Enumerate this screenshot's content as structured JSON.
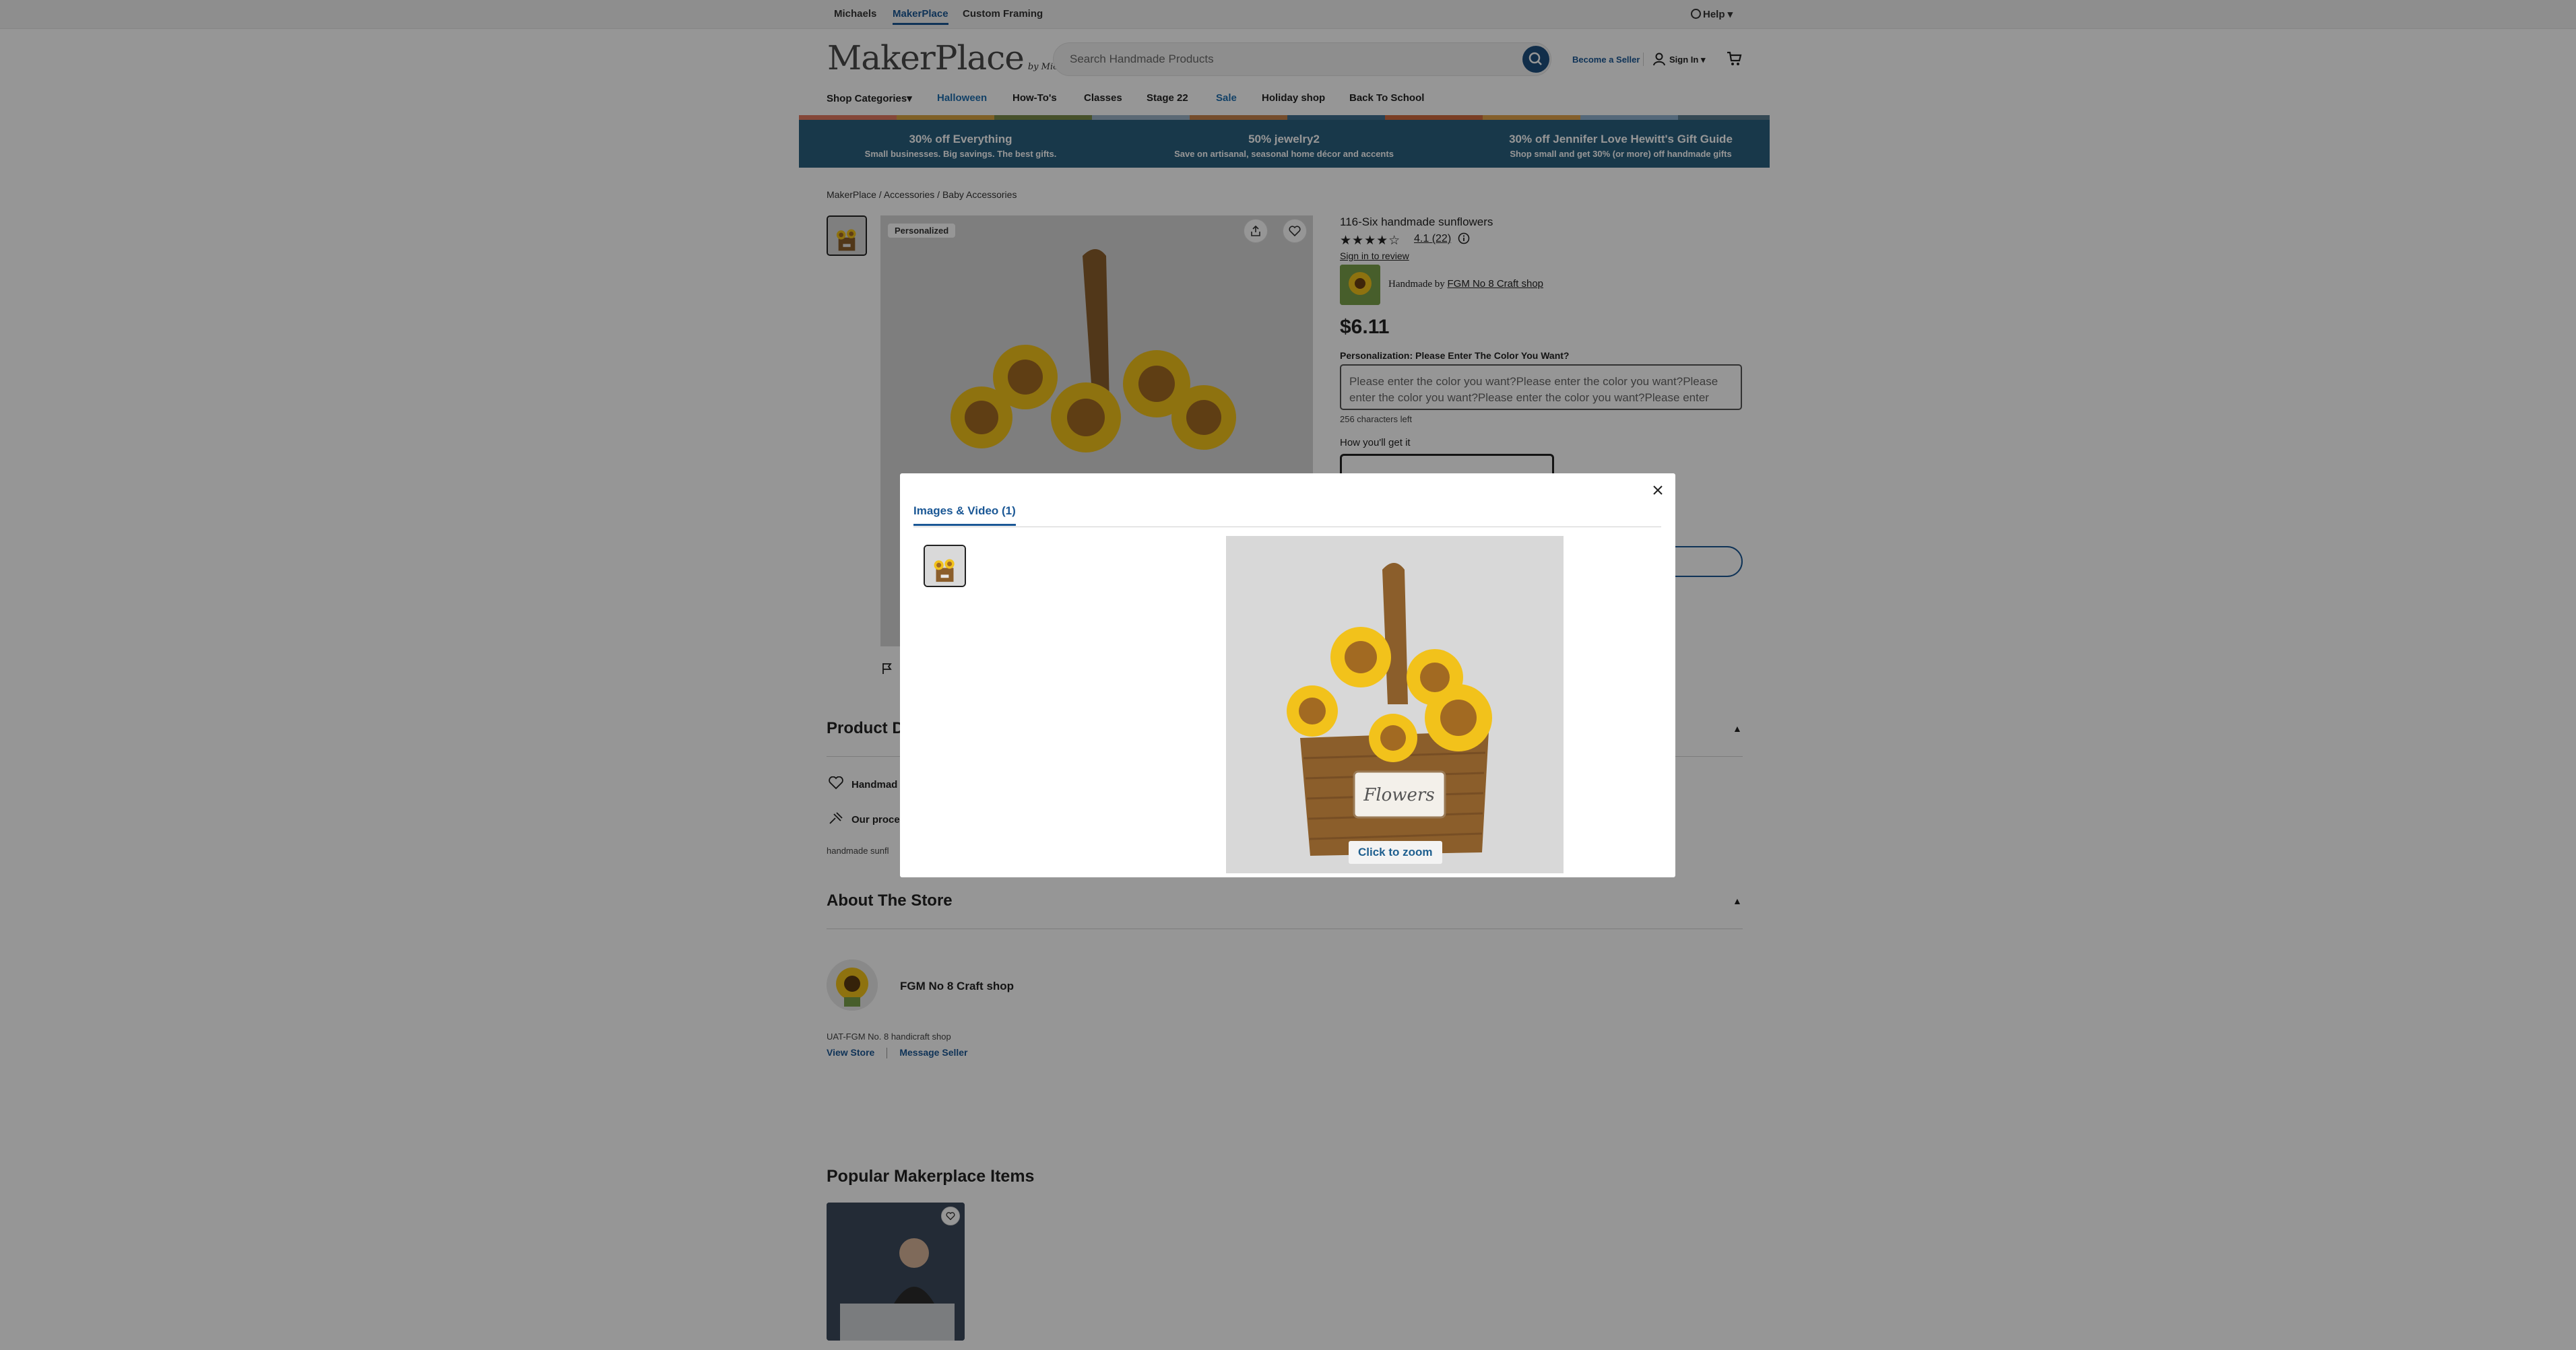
{
  "topbar": {
    "links": [
      "Michaels",
      "MakerPlace",
      "Custom Framing"
    ],
    "help": "Help"
  },
  "header": {
    "logo": "MakerPlace",
    "logo_by": "by Michaels",
    "search_placeholder": "Search Handmade Products",
    "become_seller": "Become a Seller",
    "sign_in": "Sign In"
  },
  "nav": {
    "items": [
      "Shop Categories",
      "Halloween",
      "How-To's",
      "Classes",
      "Stage 22",
      "Sale",
      "Holiday shop",
      "Back To School"
    ]
  },
  "promo": [
    {
      "title": "30% off Everything",
      "subtitle": "Small businesses. Big savings. The best gifts."
    },
    {
      "title": "50% jewelry2",
      "subtitle": "Save on artisanal, seasonal home décor and accents"
    },
    {
      "title": "30% off Jennifer Love Hewitt's Gift Guide",
      "subtitle": "Shop small and get 30% (or more) off handmade gifts"
    }
  ],
  "breadcrumb": "MakerPlace / Accessories / Baby Accessories",
  "product": {
    "tag": "Personalized",
    "title": "116-Six handmade sunflowers",
    "stars": "★★★★☆",
    "rating": 4.1,
    "rating_text": "4.1",
    "review_count": "(22)",
    "sign_in_review": "Sign in to review",
    "handmade_by": "Handmade by",
    "shop_name": "FGM No 8 Craft shop",
    "price": "$6.11",
    "personalization_label": "Personalization: Please Enter The Color You Want?",
    "personalization_value": "Please enter the color you want?Please enter the color you want?Please enter the color you want?Please enter the color you want?Please enter",
    "chars_left": "256 characters left",
    "how_get": "How you'll get it"
  },
  "details": {
    "heading": "Product D",
    "handmade": "Handmad",
    "process": "Our proce",
    "desc": "handmade sunfl"
  },
  "store": {
    "heading": "About The Store",
    "name": "FGM No 8 Craft shop",
    "desc": "UAT-FGM No. 8 handicraft shop",
    "view_store": "View Store",
    "message_seller": "Message Seller"
  },
  "popular": {
    "heading": "Popular Makerplace Items"
  },
  "modal": {
    "tab_label": "Images & Video (1)",
    "zoom_label": "Click to zoom",
    "image_label": "Flowers"
  },
  "colors": {
    "brand_blue": "#1a5795",
    "promo_bg": "#2a5f7f",
    "sunflower": "#f2c21b",
    "sunflower_center": "#a26a22",
    "basket": "#8b5e2b"
  }
}
